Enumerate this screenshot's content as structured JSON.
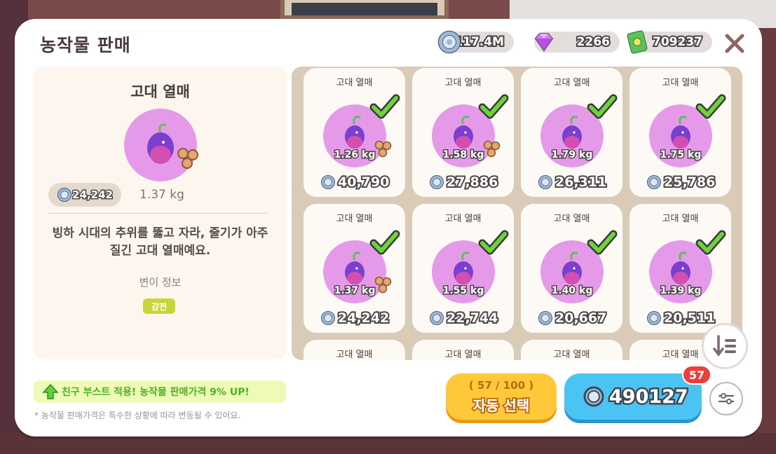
{
  "header": {
    "title": "농작물 판매",
    "coins": "117.4M",
    "gems": "2266",
    "cash": "709237"
  },
  "detail": {
    "name": "고대 열매",
    "price": "24,242",
    "weight": "1.37 kg",
    "description": "빙하 시대의 추위를 뚫고 자라, 줄기가 아주 질긴 고대 열매예요.",
    "mutation_title": "변이 정보",
    "mutation_badge": "감전"
  },
  "items": [
    {
      "name": "고대 열매",
      "weight": "1.26 kg",
      "price": "40,790",
      "seed": true,
      "checked": true
    },
    {
      "name": "고대 열매",
      "weight": "1.58 kg",
      "price": "27,886",
      "seed": true,
      "checked": true
    },
    {
      "name": "고대 열매",
      "weight": "1.79 kg",
      "price": "26,311",
      "seed": false,
      "checked": true
    },
    {
      "name": "고대 열매",
      "weight": "1.75 kg",
      "price": "25,786",
      "seed": false,
      "checked": true
    },
    {
      "name": "고대 열매",
      "weight": "1.37 kg",
      "price": "24,242",
      "seed": true,
      "checked": true
    },
    {
      "name": "고대 열매",
      "weight": "1.55 kg",
      "price": "22,744",
      "seed": false,
      "checked": true
    },
    {
      "name": "고대 열매",
      "weight": "1.40 kg",
      "price": "20,667",
      "seed": false,
      "checked": true
    },
    {
      "name": "고대 열매",
      "weight": "1.39 kg",
      "price": "20,511",
      "seed": false,
      "checked": true
    },
    {
      "name": "고대 열매"
    },
    {
      "name": "고대 열매"
    },
    {
      "name": "고대 열매"
    },
    {
      "name": "고대 열매"
    }
  ],
  "footer": {
    "boost_text": "친구 부스트 적용! 농작물 판매가격 9% UP!",
    "note": "* 농작물 판매가격은 특수한 상황에 따라 변동될 수 있어요.",
    "auto_count": "( 57 / 100 )",
    "auto_label": "자동 선택",
    "sell_total": "490127",
    "sell_badge": "57"
  },
  "colors": {
    "fruit_circle": "#e59ae9",
    "check_green": "#6cd33a",
    "auto_yellow": "#ffc83a",
    "sell_blue": "#4cc4f3",
    "badge_red": "#ef3d3b",
    "mutation_badge": "#c9d436"
  },
  "icons": [
    "coin-icon",
    "gem-icon",
    "cash-icon",
    "close-icon",
    "fruit-icon",
    "seed-icon",
    "check-icon",
    "sort-icon",
    "filter-icon",
    "arrow-up-icon"
  ]
}
